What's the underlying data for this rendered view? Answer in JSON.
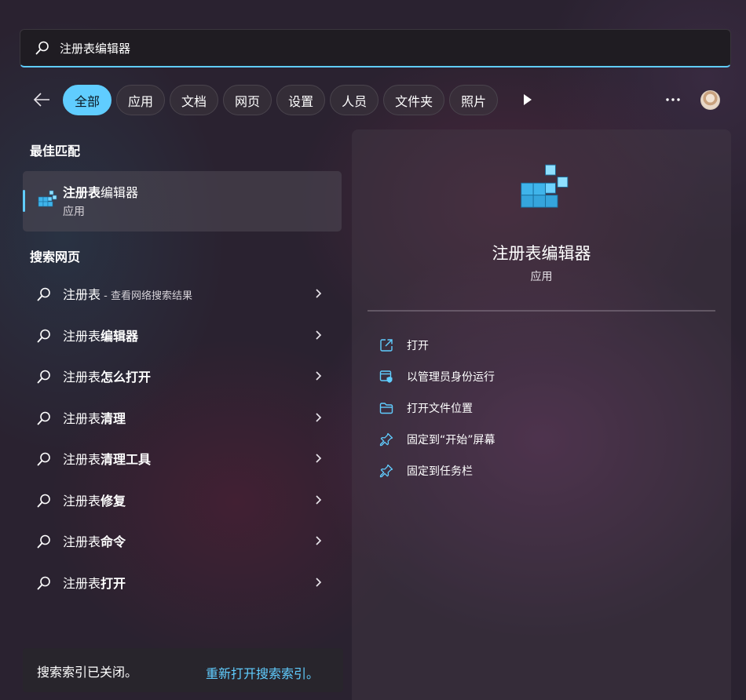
{
  "search": {
    "value": "注册表编辑器"
  },
  "filters": [
    "全部",
    "应用",
    "文档",
    "网页",
    "设置",
    "人员",
    "文件夹",
    "照片"
  ],
  "best_match": {
    "heading": "最佳匹配",
    "title_bold": "注册表",
    "title_rest": "编辑器",
    "subtitle": "应用"
  },
  "web_search": {
    "heading": "搜索网页",
    "items": [
      {
        "prefix": "注册表",
        "bold": "",
        "hint": " - 查看网络搜索结果"
      },
      {
        "prefix": "注册表",
        "bold": "编辑器",
        "hint": ""
      },
      {
        "prefix": "注册表",
        "bold": "怎么打开",
        "hint": ""
      },
      {
        "prefix": "注册表",
        "bold": "清理",
        "hint": ""
      },
      {
        "prefix": "注册表",
        "bold": "清理工具",
        "hint": ""
      },
      {
        "prefix": "注册表",
        "bold": "修复",
        "hint": ""
      },
      {
        "prefix": "注册表",
        "bold": "命令",
        "hint": ""
      },
      {
        "prefix": "注册表",
        "bold": "打开",
        "hint": ""
      }
    ]
  },
  "index_notice": {
    "message": "搜索索引已关闭。",
    "link": "重新打开搜索索引。"
  },
  "detail": {
    "title": "注册表编辑器",
    "subtitle": "应用",
    "actions": [
      {
        "icon": "open-external-icon",
        "label": "打开"
      },
      {
        "icon": "admin-shield-icon",
        "label": "以管理员身份运行"
      },
      {
        "icon": "folder-icon",
        "label": "打开文件位置"
      },
      {
        "icon": "pin-icon",
        "label": "固定到“开始”屏幕"
      },
      {
        "icon": "pin-icon",
        "label": "固定到任务栏"
      }
    ]
  },
  "colors": {
    "accent": "#60cdff"
  }
}
